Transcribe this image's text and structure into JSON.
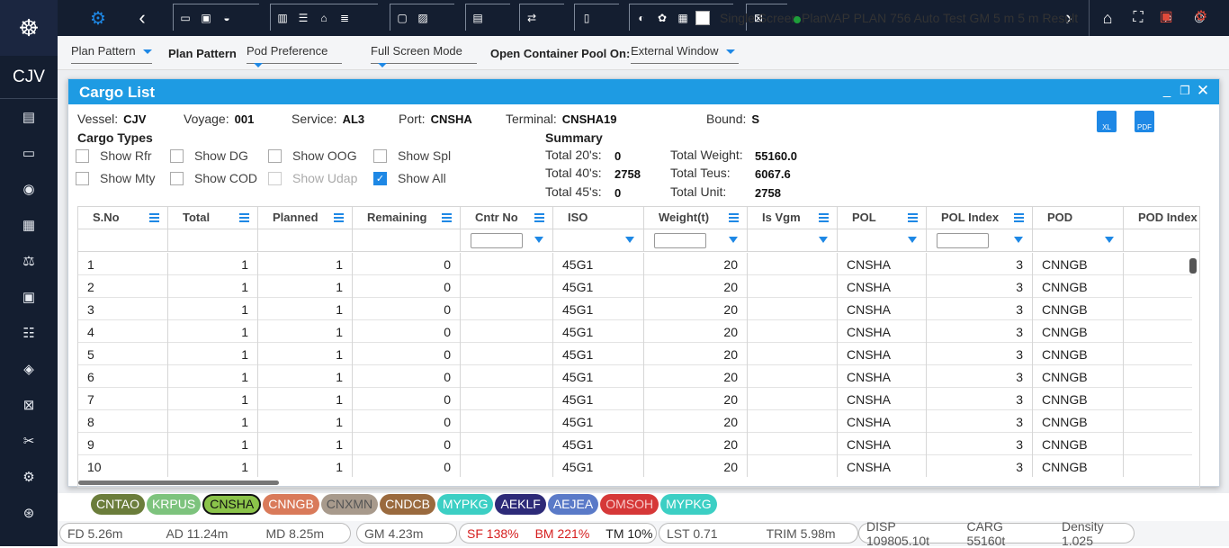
{
  "app": {
    "brand": "CJV"
  },
  "toolbar": {
    "dd1": "Plan Pattern",
    "lbl1": "Plan Pattern",
    "dd2": "Pod Preference",
    "dd3": "Full Screen Mode",
    "lbl2": "Open Container Pool On:",
    "dd4": "External Window",
    "single_label": "Single Screen Plan",
    "plan_title": "VAP PLAN 756 Auto Test GM 5 m 5 m Result"
  },
  "modal": {
    "title": "Cargo List",
    "vessel_label": "Vessel:",
    "vessel": "CJV",
    "voyage_label": "Voyage:",
    "voyage": "001",
    "service_label": "Service:",
    "service": "AL3",
    "port_label": "Port:",
    "port": "CNSHA",
    "terminal_label": "Terminal:",
    "terminal": "CNSHA19",
    "bound_label": "Bound:",
    "bound": "S",
    "cargo_types_title": "Cargo Types",
    "checkboxes": [
      "Show Rfr",
      "Show DG",
      "Show OOG",
      "Show Spl",
      "Show Mty",
      "Show COD",
      "Show Udap",
      "Show All"
    ],
    "summary_title": "Summary",
    "t20_label": "Total 20's:",
    "t20": "0",
    "t40_label": "Total 40's:",
    "t40": "2758",
    "t45_label": "Total 45's:",
    "t45": "0",
    "tw_label": "Total Weight:",
    "tw": "55160.0",
    "tt_label": "Total Teus:",
    "tt": "6067.6",
    "tu_label": "Total Unit:",
    "tu": "2758",
    "xl": "XL",
    "pdf": "PDF"
  },
  "table": {
    "columns": [
      "S.No",
      "Total",
      "Planned",
      "Remaining",
      "Cntr No",
      "ISO",
      "Weight(t)",
      "Is Vgm",
      "POL",
      "POL Index",
      "POD",
      "POD Index"
    ],
    "rows": [
      [
        "1",
        "1",
        "1",
        "0",
        "",
        "45G1",
        "20",
        "",
        "CNSHA",
        "3",
        "CNNGB"
      ],
      [
        "2",
        "1",
        "1",
        "0",
        "",
        "45G1",
        "20",
        "",
        "CNSHA",
        "3",
        "CNNGB"
      ],
      [
        "3",
        "1",
        "1",
        "0",
        "",
        "45G1",
        "20",
        "",
        "CNSHA",
        "3",
        "CNNGB"
      ],
      [
        "4",
        "1",
        "1",
        "0",
        "",
        "45G1",
        "20",
        "",
        "CNSHA",
        "3",
        "CNNGB"
      ],
      [
        "5",
        "1",
        "1",
        "0",
        "",
        "45G1",
        "20",
        "",
        "CNSHA",
        "3",
        "CNNGB"
      ],
      [
        "6",
        "1",
        "1",
        "0",
        "",
        "45G1",
        "20",
        "",
        "CNSHA",
        "3",
        "CNNGB"
      ],
      [
        "7",
        "1",
        "1",
        "0",
        "",
        "45G1",
        "20",
        "",
        "CNSHA",
        "3",
        "CNNGB"
      ],
      [
        "8",
        "1",
        "1",
        "0",
        "",
        "45G1",
        "20",
        "",
        "CNSHA",
        "3",
        "CNNGB"
      ],
      [
        "9",
        "1",
        "1",
        "0",
        "",
        "45G1",
        "20",
        "",
        "CNSHA",
        "3",
        "CNNGB"
      ],
      [
        "10",
        "1",
        "1",
        "0",
        "",
        "45G1",
        "20",
        "",
        "CNSHA",
        "3",
        "CNNGB"
      ]
    ]
  },
  "ports": [
    {
      "name": "CNTAO",
      "color": "#6b7d3b"
    },
    {
      "name": "KRPUS",
      "color": "#7dc37d"
    },
    {
      "name": "CNSHA",
      "color": "#8bc34a"
    },
    {
      "name": "CNNGB",
      "color": "#d97a5a"
    },
    {
      "name": "CNXMN",
      "color": "#a89a8c"
    },
    {
      "name": "CNDCB",
      "color": "#9a6a3e"
    },
    {
      "name": "MYPKG",
      "color": "#3ccfc4"
    },
    {
      "name": "AEKLF",
      "color": "#2d2a78"
    },
    {
      "name": "AEJEA",
      "color": "#5a7ac8"
    },
    {
      "name": "OMSOH",
      "color": "#d63838"
    },
    {
      "name": "MYPKG",
      "color": "#3ccfc4"
    }
  ],
  "status": {
    "fd": "FD 5.26m",
    "ad": "AD 11.24m",
    "md": "MD 8.25m",
    "gm": "GM 4.23m",
    "sf": "SF 138%",
    "bm": "BM 221%",
    "tm": "TM 10%",
    "lst": "LST 0.71",
    "trim": "TRIM 5.98m",
    "disp": "DISP 109805.10t",
    "carg": "CARG 55160t",
    "density": "Density 1.025"
  }
}
